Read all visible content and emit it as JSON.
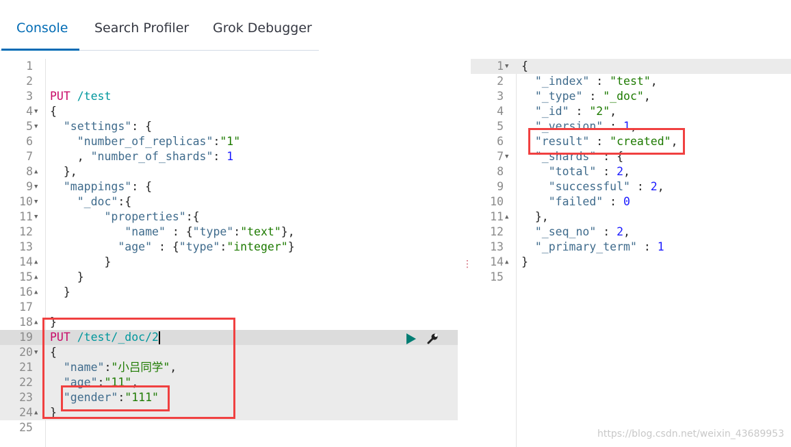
{
  "tabs": [
    {
      "label": "Console",
      "active": true
    },
    {
      "label": "Search Profiler"
    },
    {
      "label": "Grok Debugger"
    }
  ],
  "colors": {
    "accent": "#006bb4",
    "method": "#c80a68",
    "url": "#00979d",
    "string": "#1d7a00",
    "number": "#1a1aff",
    "highlight_box": "#f04040"
  },
  "request_editor": {
    "lines": [
      {
        "n": "1",
        "t": []
      },
      {
        "n": "2",
        "t": []
      },
      {
        "n": "3",
        "t": [
          [
            "method",
            "PUT"
          ],
          [
            "punc",
            " "
          ],
          [
            "url",
            "/test"
          ]
        ]
      },
      {
        "n": "4",
        "fold": "down",
        "t": [
          [
            "punc",
            "{"
          ]
        ]
      },
      {
        "n": "5",
        "fold": "down",
        "t": [
          [
            "punc",
            "  "
          ],
          [
            "key",
            "\"settings\""
          ],
          [
            "punc",
            ": {"
          ]
        ]
      },
      {
        "n": "6",
        "t": [
          [
            "punc",
            "    "
          ],
          [
            "key",
            "\"number_of_replicas\""
          ],
          [
            "punc",
            ":"
          ],
          [
            "str",
            "\"1\""
          ]
        ]
      },
      {
        "n": "7",
        "t": [
          [
            "punc",
            "    , "
          ],
          [
            "key",
            "\"number_of_shards\""
          ],
          [
            "punc",
            ": "
          ],
          [
            "num",
            "1"
          ]
        ]
      },
      {
        "n": "8",
        "fold": "up",
        "t": [
          [
            "punc",
            "  },"
          ]
        ]
      },
      {
        "n": "9",
        "fold": "down",
        "t": [
          [
            "punc",
            "  "
          ],
          [
            "key",
            "\"mappings\""
          ],
          [
            "punc",
            ": {"
          ]
        ]
      },
      {
        "n": "10",
        "fold": "down",
        "t": [
          [
            "punc",
            "    "
          ],
          [
            "key",
            "\"_doc\""
          ],
          [
            "punc",
            ":{"
          ]
        ]
      },
      {
        "n": "11",
        "fold": "down",
        "t": [
          [
            "punc",
            "        "
          ],
          [
            "key",
            "\"properties\""
          ],
          [
            "punc",
            ":{"
          ]
        ]
      },
      {
        "n": "12",
        "t": [
          [
            "punc",
            "           "
          ],
          [
            "key",
            "\"name\""
          ],
          [
            "punc",
            " : {"
          ],
          [
            "key",
            "\"type\""
          ],
          [
            "punc",
            ":"
          ],
          [
            "str",
            "\"text\""
          ],
          [
            "punc",
            "},"
          ]
        ]
      },
      {
        "n": "13",
        "t": [
          [
            "punc",
            "          "
          ],
          [
            "key",
            "\"age\""
          ],
          [
            "punc",
            " : {"
          ],
          [
            "key",
            "\"type\""
          ],
          [
            "punc",
            ":"
          ],
          [
            "str",
            "\"integer\""
          ],
          [
            "punc",
            "}"
          ]
        ]
      },
      {
        "n": "14",
        "fold": "up",
        "t": [
          [
            "punc",
            "        }"
          ]
        ]
      },
      {
        "n": "15",
        "fold": "up",
        "t": [
          [
            "punc",
            "    }"
          ]
        ]
      },
      {
        "n": "16",
        "fold": "up",
        "t": [
          [
            "punc",
            "  }"
          ]
        ]
      },
      {
        "n": "17",
        "t": []
      },
      {
        "n": "18",
        "fold": "up",
        "t": [
          [
            "punc",
            "}"
          ]
        ]
      },
      {
        "n": "19",
        "hl": "hl1",
        "cursor": true,
        "t": [
          [
            "method",
            "PUT"
          ],
          [
            "punc",
            " "
          ],
          [
            "url",
            "/test/_doc/2"
          ]
        ]
      },
      {
        "n": "20",
        "hl": "hl2",
        "fold": "down",
        "t": [
          [
            "punc",
            "{"
          ]
        ]
      },
      {
        "n": "21",
        "hl": "hl2",
        "t": [
          [
            "punc",
            "  "
          ],
          [
            "key",
            "\"name\""
          ],
          [
            "punc",
            ":"
          ],
          [
            "str",
            "\"小吕同学\""
          ],
          [
            "punc",
            ","
          ]
        ]
      },
      {
        "n": "22",
        "hl": "hl2",
        "t": [
          [
            "punc",
            "  "
          ],
          [
            "key",
            "\"age\""
          ],
          [
            "punc",
            ":"
          ],
          [
            "str",
            "\"11\""
          ],
          [
            "punc",
            ","
          ]
        ]
      },
      {
        "n": "23",
        "hl": "hl2",
        "t": [
          [
            "punc",
            "  "
          ],
          [
            "key",
            "\"gender\""
          ],
          [
            "punc",
            ":"
          ],
          [
            "str",
            "\"111\""
          ]
        ]
      },
      {
        "n": "24",
        "hl": "hl2",
        "fold": "up",
        "t": [
          [
            "punc",
            "}"
          ]
        ]
      },
      {
        "n": "25",
        "t": []
      }
    ]
  },
  "response_editor": {
    "lines": [
      {
        "n": "1",
        "hl": "hl2",
        "fold": "down",
        "t": [
          [
            "punc",
            "{"
          ]
        ]
      },
      {
        "n": "2",
        "t": [
          [
            "punc",
            "  "
          ],
          [
            "key",
            "\"_index\""
          ],
          [
            "punc",
            " : "
          ],
          [
            "str",
            "\"test\""
          ],
          [
            "punc",
            ","
          ]
        ]
      },
      {
        "n": "3",
        "t": [
          [
            "punc",
            "  "
          ],
          [
            "key",
            "\"_type\""
          ],
          [
            "punc",
            " : "
          ],
          [
            "str",
            "\"_doc\""
          ],
          [
            "punc",
            ","
          ]
        ]
      },
      {
        "n": "4",
        "t": [
          [
            "punc",
            "  "
          ],
          [
            "key",
            "\"_id\""
          ],
          [
            "punc",
            " : "
          ],
          [
            "str",
            "\"2\""
          ],
          [
            "punc",
            ","
          ]
        ]
      },
      {
        "n": "5",
        "t": [
          [
            "punc",
            "  "
          ],
          [
            "key",
            "\"_version\""
          ],
          [
            "punc",
            " : "
          ],
          [
            "num",
            "1"
          ],
          [
            "punc",
            ","
          ]
        ]
      },
      {
        "n": "6",
        "t": [
          [
            "punc",
            "  "
          ],
          [
            "key",
            "\"result\""
          ],
          [
            "punc",
            " : "
          ],
          [
            "str",
            "\"created\""
          ],
          [
            "punc",
            ","
          ]
        ]
      },
      {
        "n": "7",
        "fold": "down",
        "t": [
          [
            "punc",
            "  "
          ],
          [
            "key",
            "\"_shards\""
          ],
          [
            "punc",
            " : {"
          ]
        ]
      },
      {
        "n": "8",
        "t": [
          [
            "punc",
            "    "
          ],
          [
            "key",
            "\"total\""
          ],
          [
            "punc",
            " : "
          ],
          [
            "num",
            "2"
          ],
          [
            "punc",
            ","
          ]
        ]
      },
      {
        "n": "9",
        "t": [
          [
            "punc",
            "    "
          ],
          [
            "key",
            "\"successful\""
          ],
          [
            "punc",
            " : "
          ],
          [
            "num",
            "2"
          ],
          [
            "punc",
            ","
          ]
        ]
      },
      {
        "n": "10",
        "t": [
          [
            "punc",
            "    "
          ],
          [
            "key",
            "\"failed\""
          ],
          [
            "punc",
            " : "
          ],
          [
            "num",
            "0"
          ]
        ]
      },
      {
        "n": "11",
        "fold": "up",
        "t": [
          [
            "punc",
            "  },"
          ]
        ]
      },
      {
        "n": "12",
        "t": [
          [
            "punc",
            "  "
          ],
          [
            "key",
            "\"_seq_no\""
          ],
          [
            "punc",
            " : "
          ],
          [
            "num",
            "2"
          ],
          [
            "punc",
            ","
          ]
        ]
      },
      {
        "n": "13",
        "t": [
          [
            "punc",
            "  "
          ],
          [
            "key",
            "\"_primary_term\""
          ],
          [
            "punc",
            " : "
          ],
          [
            "num",
            "1"
          ]
        ]
      },
      {
        "n": "14",
        "fold": "up",
        "t": [
          [
            "punc",
            "}"
          ]
        ]
      },
      {
        "n": "15",
        "t": []
      }
    ]
  },
  "watermark": "https://blog.csdn.net/weixin_43689953"
}
